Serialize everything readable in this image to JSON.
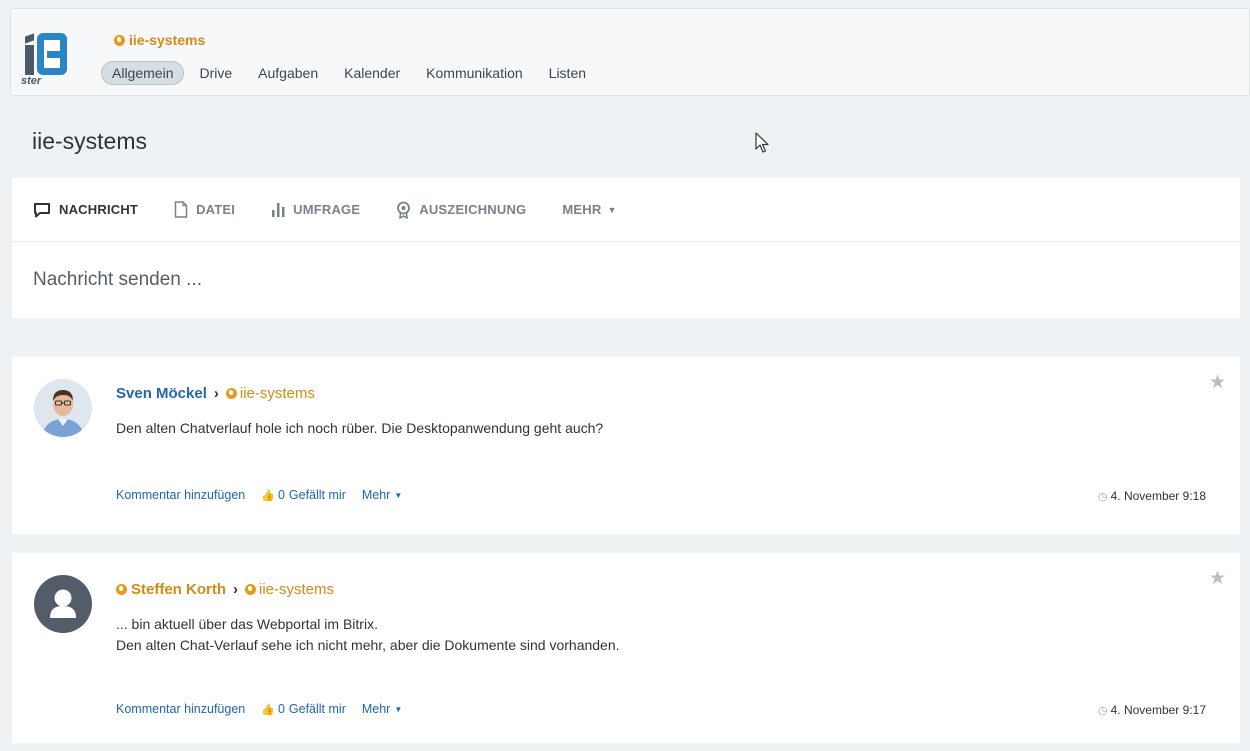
{
  "header": {
    "logo_text": "ster",
    "group_name": "iie-systems",
    "nav": [
      {
        "label": "Allgemein",
        "active": true
      },
      {
        "label": "Drive",
        "active": false
      },
      {
        "label": "Aufgaben",
        "active": false
      },
      {
        "label": "Kalender",
        "active": false
      },
      {
        "label": "Kommunikation",
        "active": false
      },
      {
        "label": "Listen",
        "active": false
      }
    ]
  },
  "page_title": "iie-systems",
  "composer": {
    "tabs": {
      "message": "NACHRICHT",
      "file": "DATEI",
      "poll": "UMFRAGE",
      "award": "AUSZEICHNUNG",
      "more": "MEHR"
    },
    "placeholder": "Nachricht senden ..."
  },
  "posts": [
    {
      "author": "Sven Möckel",
      "target": "iie-systems",
      "lines": [
        "Den alten Chatverlauf hole ich noch rüber. Die Desktopanwendung geht auch?"
      ],
      "comment_label": "Kommentar hinzufügen",
      "like_count": "0",
      "like_label": "Gefällt mir",
      "more_label": "Mehr",
      "timestamp": "4. November 9:18"
    },
    {
      "author": "Steffen Korth",
      "target": "iie-systems",
      "lines": [
        "... bin aktuell über das Webportal im Bitrix.",
        "Den alten Chat-Verlauf sehe ich nicht mehr, aber die Dokumente sind vorhanden."
      ],
      "comment_label": "Kommentar hinzufügen",
      "like_count": "0",
      "like_label": "Gefällt mir",
      "more_label": "Mehr",
      "timestamp": "4. November 9:17"
    }
  ],
  "colors": {
    "accent_blue": "#2067b0",
    "group_orange": "#d48a17",
    "background": "#eef2f4"
  }
}
